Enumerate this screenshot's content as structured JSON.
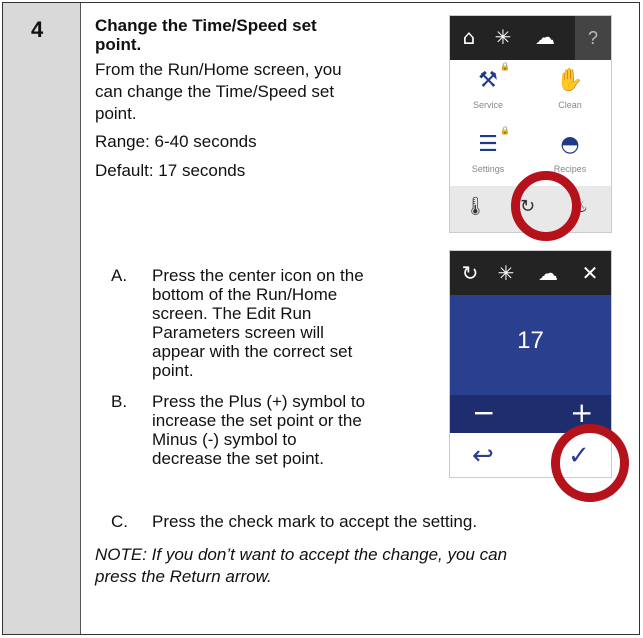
{
  "step": {
    "number": "4",
    "title_line1": "Change the Time/Speed set",
    "title_line2": "point.",
    "intro_line1": "From the Run/Home screen, you",
    "intro_line2": "can change the Time/Speed set",
    "intro_line3": "point.",
    "range": "Range: 6-40 seconds",
    "default": "Default: 17 seconds"
  },
  "substeps": [
    {
      "label": "A.",
      "lines": [
        "Press the center icon on the",
        "bottom of the Run/Home",
        "screen. The Edit Run",
        "Parameters screen will",
        "appear with the correct set",
        "point."
      ]
    },
    {
      "label": "B.",
      "lines": [
        "Press the Plus (+) symbol to",
        "increase the set point or the",
        "Minus (-) symbol to",
        "decrease the set point."
      ]
    },
    {
      "label": "C.",
      "lines": [
        "Press the check mark to accept the setting."
      ]
    }
  ],
  "note_line1": "NOTE: If you don’t want to accept the change, you can",
  "note_line2": "press the Return arrow.",
  "screen1": {
    "help": "?",
    "tiles": [
      "Service",
      "Clean",
      "Settings",
      "Recipes"
    ]
  },
  "screen2": {
    "value": "17",
    "minus": "−",
    "plus": "+"
  },
  "colors": {
    "accent_ring": "#b5121b",
    "screen_blue": "#2b3f8f",
    "step_bar": "#d9d9d9"
  }
}
